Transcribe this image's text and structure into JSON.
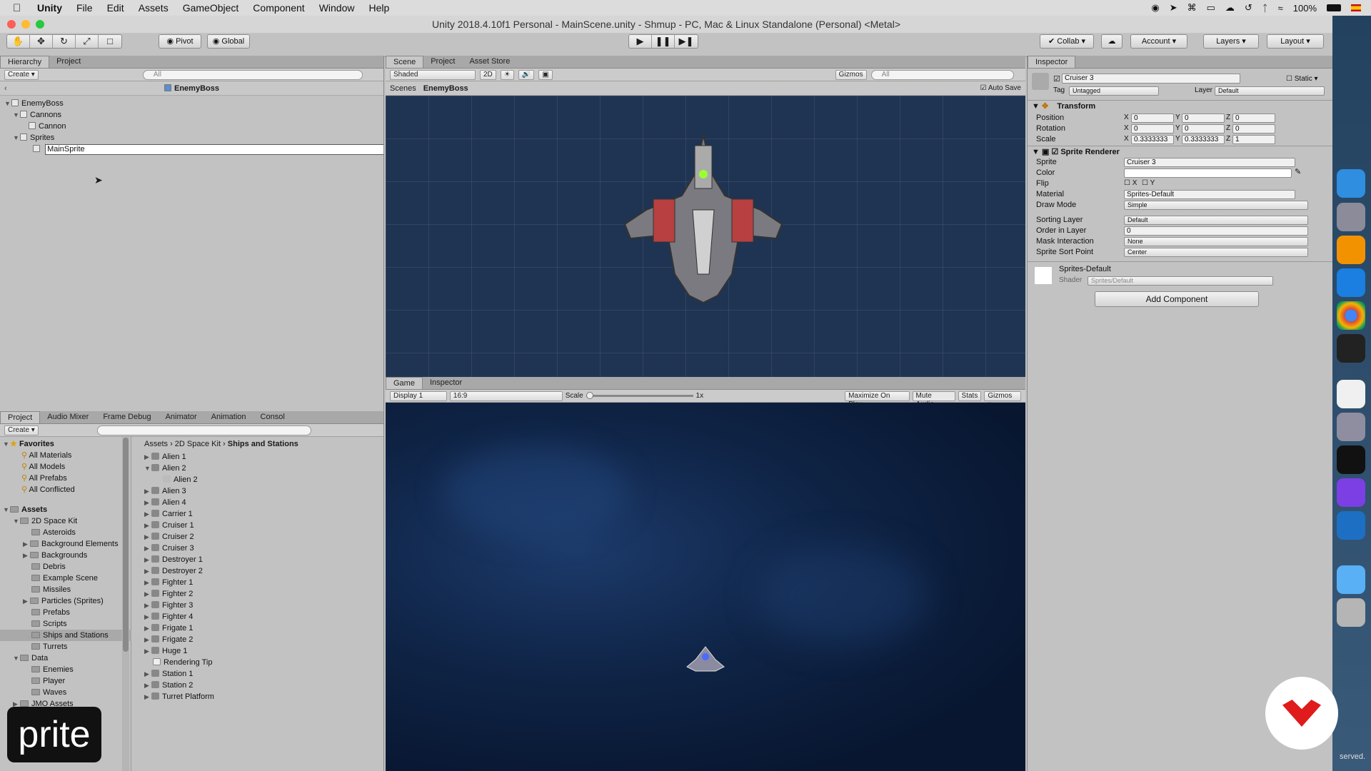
{
  "menubar": {
    "app": "Unity",
    "items": [
      "File",
      "Edit",
      "Assets",
      "GameObject",
      "Component",
      "Window",
      "Help"
    ],
    "battery": "100%"
  },
  "window": {
    "title": "Unity 2018.4.10f1 Personal - MainScene.unity - Shmup - PC, Mac & Linux Standalone (Personal) <Metal>"
  },
  "toolbar": {
    "pivot": "Pivot",
    "global": "Global",
    "collab": "Collab",
    "account": "Account",
    "layers": "Layers",
    "layout": "Layout"
  },
  "hierarchy": {
    "tab1": "Hierarchy",
    "tab2": "Project",
    "create": "Create",
    "search_placeholder": "All",
    "prefab_title": "EnemyBoss",
    "items": [
      {
        "label": "EnemyBoss"
      },
      {
        "label": "Cannons"
      },
      {
        "label": "Cannon"
      },
      {
        "label": "Sprites"
      },
      {
        "label": "MainSprite"
      }
    ]
  },
  "scene": {
    "tabs": [
      "Scene",
      "Project",
      "Asset Store"
    ],
    "shaded": "Shaded",
    "mode2d": "2D",
    "gizmos": "Gizmos",
    "search_placeholder": "All",
    "crumb1": "Scenes",
    "crumb2": "EnemyBoss",
    "autosave": "Auto Save"
  },
  "game": {
    "tabs": [
      "Game",
      "Inspector"
    ],
    "display": "Display 1",
    "aspect": "16:9",
    "scale_label": "Scale",
    "scale_value": "1x",
    "maximize": "Maximize On Play",
    "mute": "Mute Audio",
    "stats": "Stats",
    "gizmos": "Gizmos"
  },
  "project": {
    "tabs": [
      "Project",
      "Audio Mixer",
      "Frame Debug",
      "Animator",
      "Animation",
      "Consol"
    ],
    "create": "Create",
    "favorites_label": "Favorites",
    "favorites": [
      "All Materials",
      "All Models",
      "All Prefabs",
      "All Conflicted"
    ],
    "assets_label": "Assets",
    "tree": [
      "2D Space Kit",
      "Asteroids",
      "Background Elements",
      "Backgrounds",
      "Debris",
      "Example Scene",
      "Missiles",
      "Particles (Sprites)",
      "Prefabs",
      "Scripts",
      "Ships and Stations",
      "Turrets",
      "Data",
      "Enemies",
      "Player",
      "Waves",
      "JMO Assets"
    ],
    "breadcrumb": [
      "Assets",
      "2D Space Kit",
      "Ships and Stations"
    ],
    "files": [
      "Alien 1",
      "Alien 2",
      "Alien 2",
      "Alien 3",
      "Alien 4",
      "Carrier 1",
      "Cruiser 1",
      "Cruiser 2",
      "Cruiser 3",
      "Destroyer 1",
      "Destroyer 2",
      "Fighter 1",
      "Fighter 2",
      "Fighter 3",
      "Fighter 4",
      "Frigate 1",
      "Frigate 2",
      "Huge 1",
      "Rendering Tip",
      "Station 1",
      "Station 2",
      "Turret Platform"
    ]
  },
  "inspector": {
    "tab": "Inspector",
    "object_name": "Cruiser 3",
    "static": "Static",
    "tag_label": "Tag",
    "tag": "Untagged",
    "layer_label": "Layer",
    "layer": "Default",
    "transform": {
      "title": "Transform",
      "position": {
        "label": "Position",
        "x": "0",
        "y": "0",
        "z": "0"
      },
      "rotation": {
        "label": "Rotation",
        "x": "0",
        "y": "0",
        "z": "0"
      },
      "scale": {
        "label": "Scale",
        "x": "0.3333333",
        "y": "0.3333333",
        "z": "1"
      }
    },
    "sprite_renderer": {
      "title": "Sprite Renderer",
      "sprite_label": "Sprite",
      "sprite": "Cruiser 3",
      "color_label": "Color",
      "flip_label": "Flip",
      "flip_x": "X",
      "flip_y": "Y",
      "material_label": "Material",
      "material": "Sprites-Default",
      "draw_mode_label": "Draw Mode",
      "draw_mode": "Simple",
      "sorting_layer_label": "Sorting Layer",
      "sorting_layer": "Default",
      "order_label": "Order in Layer",
      "order": "0",
      "mask_label": "Mask Interaction",
      "mask": "None",
      "sort_point_label": "Sprite Sort Point",
      "sort_point": "Center"
    },
    "material_block": {
      "name": "Sprites-Default",
      "shader_label": "Shader",
      "shader": "Sprites/Default"
    },
    "add_component": "Add Component"
  },
  "overlay": {
    "caption": "prite",
    "corner_text": "served."
  },
  "colors": {
    "scene_bg": "#1f3452",
    "game_bg": "#0c1e3a",
    "selection": "#7a9cc6",
    "accent_red": "#e01b1b"
  }
}
